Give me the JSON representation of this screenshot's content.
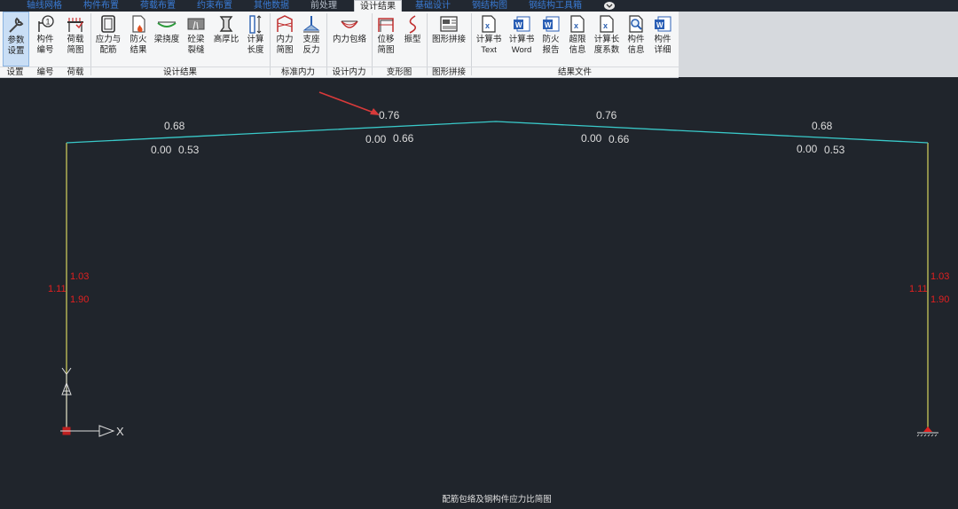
{
  "tabs": [
    {
      "label": "轴线网格",
      "state": "blue"
    },
    {
      "label": "构件布置",
      "state": "blue"
    },
    {
      "label": "荷载布置",
      "state": "blue"
    },
    {
      "label": "约束布置",
      "state": "blue"
    },
    {
      "label": "其他数据",
      "state": "blue"
    },
    {
      "label": "前处理",
      "state": "dim"
    },
    {
      "label": "设计结果",
      "state": "active"
    },
    {
      "label": "基础设计",
      "state": "blue"
    },
    {
      "label": "钢结构图",
      "state": "blue"
    },
    {
      "label": "钢结构工具箱",
      "state": "blue"
    }
  ],
  "ribbon": {
    "buttons": [
      {
        "id": "params",
        "label": "参数\n设置",
        "icon": "wrench-icon",
        "selected": true
      },
      {
        "id": "member-no",
        "label": "构件\n编号",
        "icon": "number-tag-icon"
      },
      {
        "id": "load-diagram",
        "label": "荷载\n简图",
        "icon": "load-diagram-icon"
      },
      {
        "id": "stress",
        "label": "应力与\n配筋",
        "icon": "stress-ratio-icon"
      },
      {
        "id": "fire",
        "label": "防火\n结果",
        "icon": "fire-document-icon"
      },
      {
        "id": "deflection",
        "label": "梁挠度",
        "icon": "beam-deflection-icon"
      },
      {
        "id": "crack",
        "label": "砼梁\n裂缝",
        "icon": "beam-crack-icon"
      },
      {
        "id": "ratio",
        "label": "高厚比",
        "icon": "wall-ratio-icon"
      },
      {
        "id": "calc-len",
        "label": "计算\n长度",
        "icon": "column-length-icon"
      },
      {
        "id": "internal",
        "label": "内力\n简图",
        "icon": "internal-force-icon"
      },
      {
        "id": "reaction",
        "label": "支座\n反力",
        "icon": "support-reaction-icon"
      },
      {
        "id": "envelope",
        "label": "内力包络",
        "icon": "force-envelope-icon"
      },
      {
        "id": "disp",
        "label": "位移\n简图",
        "icon": "displacement-icon"
      },
      {
        "id": "mode",
        "label": "振型",
        "icon": "vibration-mode-icon"
      },
      {
        "id": "stitch",
        "label": "图形拼接",
        "icon": "graphic-stitch-icon"
      },
      {
        "id": "calc-text",
        "label": "计算书\nText",
        "icon": "calc-text-icon"
      },
      {
        "id": "calc-word",
        "label": "计算书\nWord",
        "icon": "word-icon"
      },
      {
        "id": "fire-report",
        "label": "防火\n报告",
        "icon": "fire-report-icon"
      },
      {
        "id": "overlimit",
        "label": "超限\n信息",
        "icon": "overlimit-doc-icon"
      },
      {
        "id": "len-coef",
        "label": "计算长\n度系数",
        "icon": "length-coef-doc-icon"
      },
      {
        "id": "member-info",
        "label": "构件\n信息",
        "icon": "magnifier-doc-icon"
      },
      {
        "id": "member-detail",
        "label": "构件\n详细",
        "icon": "word-detail-icon"
      }
    ],
    "groups": [
      "设置",
      "编号",
      "荷载",
      "设计结果",
      "标准内力",
      "设计内力",
      "变形图",
      "图形拼接",
      "结果文件"
    ]
  },
  "drawing": {
    "caption": "配筋包络及钢构件应力比简图",
    "colors": {
      "background": "#20252c",
      "beam": "#39c9c9",
      "column": "#c8c85a",
      "text": "#dddddd",
      "red": "#e02020",
      "arrow": "#d83a3a",
      "axis": "#dddddd"
    },
    "beam_labels": {
      "left_top": "0.68",
      "left_b1": "0.00",
      "left_b2": "0.53",
      "mid_l_top": "0.76",
      "mid_l_b1": "0.00",
      "mid_l_b2": "0.66",
      "mid_r_top": "0.76",
      "mid_r_b1": "0.00",
      "mid_r_b2": "0.66",
      "right_top": "0.68",
      "right_b1": "0.00",
      "right_b2": "0.53"
    },
    "column_labels": {
      "left_outer": "1.11",
      "left_a": "1.03",
      "left_b": "1.90",
      "right_outer": "1.11",
      "right_a": "1.03",
      "right_b": "1.90"
    },
    "axis_label": "X"
  }
}
